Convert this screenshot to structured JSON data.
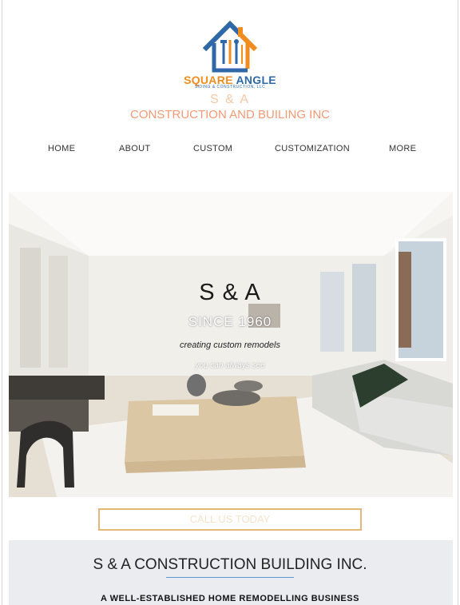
{
  "logo": {
    "brand_part1": "SQUARE",
    "brand_part2": "ANGLE",
    "tagline": "SIDING & CONSTRUCTION, LLC",
    "icon": "house-tools-icon"
  },
  "header": {
    "short_name": "S & A",
    "company_name": "CONSTRUCTION AND BUILING INC"
  },
  "nav": {
    "items": [
      "HOME",
      "ABOUT",
      "CUSTOM",
      "CUSTOMIZATION",
      "MORE"
    ]
  },
  "hero": {
    "title": "S & A",
    "since": "SINCE 1960",
    "subtitle": "creating custom remodels",
    "subtitle2": "you can always see"
  },
  "cta": {
    "label": "CALL US TODAY"
  },
  "section": {
    "title": "S & A CONSTRUCTION BUILDING INC.",
    "subtitle": "A WELL-ESTABLISHED HOME REMODELLING BUSINESS"
  },
  "colors": {
    "brand_orange": "#f28c1e",
    "brand_blue": "#2f68a8",
    "company_name": "#f39a76",
    "cta_border": "#e3b67a",
    "section_bg": "#eaecf0"
  }
}
